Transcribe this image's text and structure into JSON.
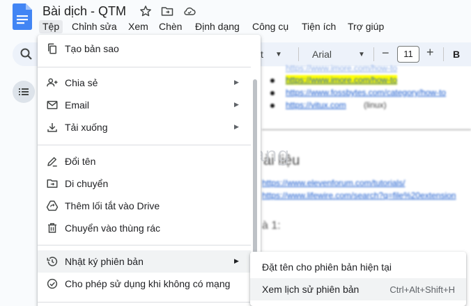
{
  "header": {
    "doc_title": "Bài dịch - QTM",
    "icons": [
      "star-icon",
      "move-to-folder-icon",
      "cloud-status-icon"
    ]
  },
  "menubar": {
    "items": [
      "Tệp",
      "Chỉnh sửa",
      "Xem",
      "Chèn",
      "Định dạng",
      "Công cụ",
      "Tiện ích",
      "Trợ giúp"
    ],
    "active": "Tệp"
  },
  "toolbar": {
    "font_name": "Arial",
    "font_size": "11",
    "minus": "−",
    "plus": "+",
    "bold": "B",
    "partial_label": "t"
  },
  "file_menu": {
    "items": [
      {
        "label": "Tạo bản sao",
        "icon": "copy-icon",
        "submenu": false
      },
      {
        "label": "Chia sẻ",
        "icon": "person-add-icon",
        "submenu": true
      },
      {
        "label": "Email",
        "icon": "mail-icon",
        "submenu": true
      },
      {
        "label": "Tải xuống",
        "icon": "download-icon",
        "submenu": true
      },
      {
        "label": "Đổi tên",
        "icon": "rename-pencil-icon",
        "submenu": false
      },
      {
        "label": "Di chuyển",
        "icon": "move-folder-icon",
        "submenu": false
      },
      {
        "label": "Thêm lối tắt vào Drive",
        "icon": "drive-shortcut-icon",
        "submenu": false
      },
      {
        "label": "Chuyển vào thùng rác",
        "icon": "trash-icon",
        "submenu": false
      },
      {
        "label": "Nhật ký phiên bản",
        "icon": "history-icon",
        "submenu": true
      },
      {
        "label": "Cho phép sử dụng khi không có mạng",
        "icon": "offline-check-icon",
        "submenu": false
      }
    ]
  },
  "version_submenu": {
    "items": [
      {
        "label": "Đặt tên cho phiên bản hiện tại",
        "shortcut": ""
      },
      {
        "label": "Xem lịch sử phiên bản",
        "shortcut": "Ctrl+Alt+Shift+H"
      }
    ]
  },
  "document": {
    "links": [
      "https://www.imore.com/how-to",
      "https://www.fossbytes.com/category/how-to",
      "https://vitux.com",
      "https://www.elevenforum.com/tutorials/",
      "https://www.lifewire.com/search?q=file%20extension"
    ],
    "note": "(linux)",
    "heading": "ài liệu",
    "subheading": "à 1:"
  },
  "watermark": {
    "text": "uantrimang"
  },
  "colors": {
    "accent_blue": "#1a73e8",
    "highlight": "#ffff00",
    "link": "#1155cc"
  }
}
